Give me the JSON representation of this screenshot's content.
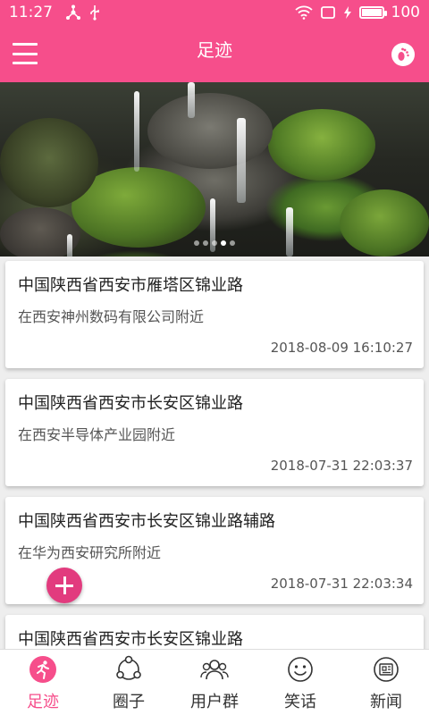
{
  "status_bar": {
    "time": "11:27",
    "battery": "100",
    "battery_level": 1.0
  },
  "app_bar": {
    "title": "足迹",
    "menu_icon": "menu-icon",
    "action_icon": "footprint-icon"
  },
  "banner": {
    "image": "waterfall-rocks-photo",
    "slide_count": 5,
    "active_slide": 4
  },
  "records": [
    {
      "address": "中国陕西省西安市雁塔区锦业路",
      "nearby": "在西安神州数码有限公司附近",
      "time": "2018-08-09 16:10:27"
    },
    {
      "address": "中国陕西省西安市长安区锦业路",
      "nearby": "在西安半导体产业园附近",
      "time": "2018-07-31 22:03:37"
    },
    {
      "address": "中国陕西省西安市长安区锦业路辅路",
      "nearby": "在华为西安研究所附近",
      "time": "2018-07-31 22:03:34"
    },
    {
      "address": "中国陕西省西安市长安区锦业路",
      "nearby": "",
      "time": ""
    }
  ],
  "fab": {
    "icon": "plus-icon"
  },
  "tabs": [
    {
      "label": "足迹",
      "icon": "footprint-run-icon",
      "active": true
    },
    {
      "label": "圈子",
      "icon": "circle-people-icon",
      "active": false
    },
    {
      "label": "用户群",
      "icon": "user-group-icon",
      "active": false
    },
    {
      "label": "笑话",
      "icon": "smile-icon",
      "active": false
    },
    {
      "label": "新闻",
      "icon": "news-icon",
      "active": false
    }
  ],
  "colors": {
    "primary": "#f64e8b",
    "fab": "#e23b7e"
  }
}
